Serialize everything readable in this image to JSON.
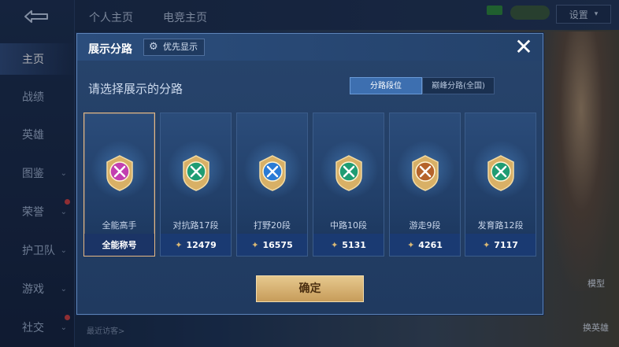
{
  "sidebar": {
    "items": [
      {
        "label": "主页",
        "active": true,
        "chevron": false,
        "dot": false
      },
      {
        "label": "战绩",
        "active": false,
        "chevron": false,
        "dot": false
      },
      {
        "label": "英雄",
        "active": false,
        "chevron": false,
        "dot": false
      },
      {
        "label": "图鉴",
        "active": false,
        "chevron": true,
        "dot": false
      },
      {
        "label": "荣誉",
        "active": false,
        "chevron": true,
        "dot": true
      },
      {
        "label": "护卫队",
        "active": false,
        "chevron": true,
        "dot": false
      },
      {
        "label": "游戏",
        "active": false,
        "chevron": true,
        "dot": false
      },
      {
        "label": "社交",
        "active": false,
        "chevron": true,
        "dot": true
      }
    ]
  },
  "topbar": {
    "tabs": [
      "个人主页",
      "电竞主页"
    ],
    "settings_label": "设置"
  },
  "right_panel": {
    "model_label": "模型",
    "change_hero_label": "换英雄"
  },
  "bottom": {
    "recent_visitors_label": "最近访客>"
  },
  "modal": {
    "title": "展示分路",
    "priority_label": "优先显示",
    "close_icon": "close-icon",
    "subtitle": "请选择展示的分路",
    "segments": [
      "分路段位",
      "巅峰分路(全国)"
    ],
    "active_segment": 0,
    "cards": [
      {
        "role": "全能高手",
        "footer": "全能称号",
        "value": "",
        "selected": true,
        "color": "#c23fb0"
      },
      {
        "role": "对抗路17段",
        "footer": "",
        "value": "12479",
        "selected": false,
        "color": "#1f9c73"
      },
      {
        "role": "打野20段",
        "footer": "",
        "value": "16575",
        "selected": false,
        "color": "#2a7bd6"
      },
      {
        "role": "中路10段",
        "footer": "",
        "value": "5131",
        "selected": false,
        "color": "#1f9c73"
      },
      {
        "role": "游走9段",
        "footer": "",
        "value": "4261",
        "selected": false,
        "color": "#b5632b"
      },
      {
        "role": "发育路12段",
        "footer": "",
        "value": "7117",
        "selected": false,
        "color": "#1f9c73"
      }
    ],
    "confirm_label": "确定"
  }
}
